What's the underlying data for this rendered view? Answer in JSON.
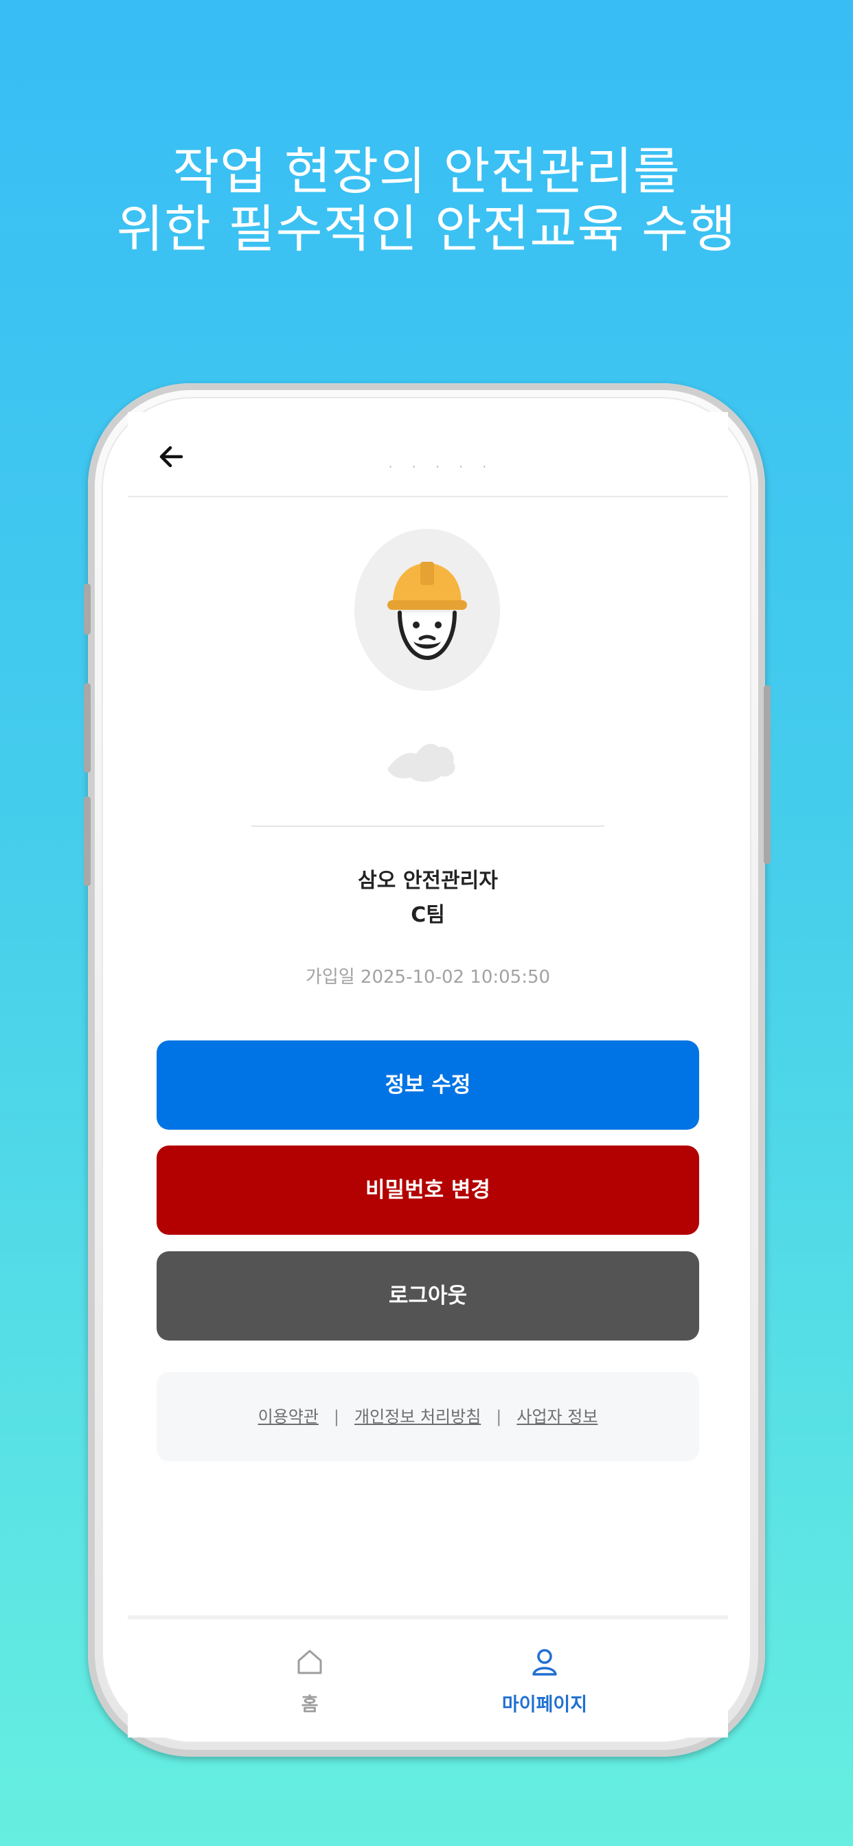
{
  "headline": {
    "line1": "작업 현장의 안전관리를",
    "line2": "위한 필수적인 안전교육 수행"
  },
  "topbar": {
    "back_icon": "arrow-left-icon",
    "title_placeholder": "· · · · ·"
  },
  "profile": {
    "avatar_icon": "worker-hardhat-icon",
    "name": "삼오 안전관리자",
    "team": "C팀",
    "joined": "가입일 2025-10-02 10:05:50"
  },
  "buttons": {
    "edit_info": "정보 수정",
    "change_password": "비밀번호 변경",
    "logout": "로그아웃"
  },
  "footer_links": {
    "terms": "이용약관",
    "privacy": "개인정보 처리방침",
    "business": "사업자 정보",
    "separator": "|"
  },
  "tabbar": {
    "home": "홈",
    "mypage": "마이페이지"
  },
  "colors": {
    "edit_button": "#0074e4",
    "password_button": "#b30000",
    "logout_button": "#545454",
    "active_tab": "#1f6fd1",
    "helmet": "#f5b540"
  }
}
